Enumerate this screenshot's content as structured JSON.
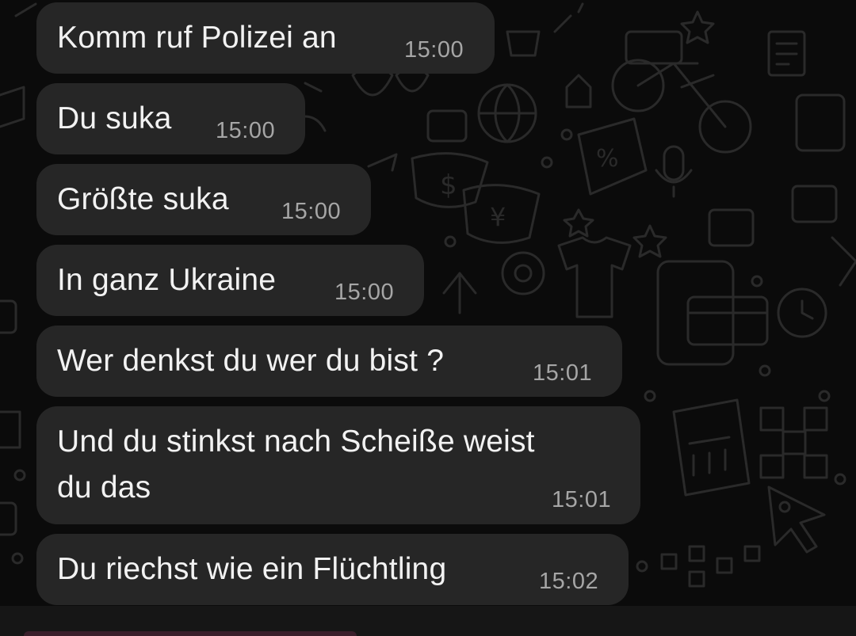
{
  "conversation": {
    "messages": [
      {
        "text": "Komm ruf Polizei an",
        "time": "15:00"
      },
      {
        "text": "Du suka",
        "time": "15:00"
      },
      {
        "text": "Größte suka",
        "time": "15:00"
      },
      {
        "text": "In ganz Ukraine",
        "time": "15:00"
      },
      {
        "text": "Wer denkst du wer du bist ?",
        "time": "15:01"
      },
      {
        "text_line1": "Und du stinkst nach Scheiße weist",
        "text_line2": "du das",
        "time": "15:01"
      },
      {
        "text": "Du riechst wie ein Flüchtling",
        "time": "15:02"
      }
    ]
  },
  "colors": {
    "background": "#0b0b0b",
    "bubble": "#262626",
    "message_text": "#f2f2f2",
    "timestamp": "#a6a6a6",
    "wallpaper_pattern": "#2a2a2a"
  }
}
